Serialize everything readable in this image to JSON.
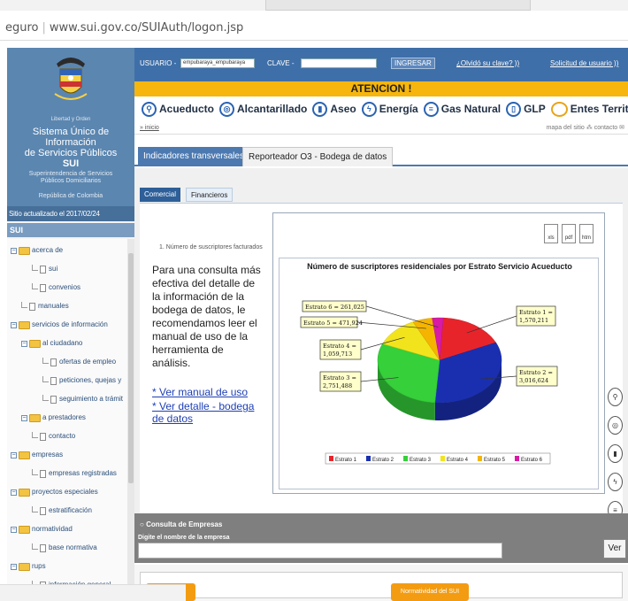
{
  "browser": {
    "url_prefix": "eguro",
    "url": "www.sui.gov.co/SUIAuth/logon.jsp"
  },
  "sidebar": {
    "crest_caption": "Libertad y Orden",
    "title_line1": "Sistema Único de Información",
    "title_line2": "de Servicios Públicos",
    "title_line3": "SUI",
    "sub_line1": "Superintendencia de Servicios",
    "sub_line2": "Públicos Domiciliarios",
    "sub_line3": "República de Colombia",
    "updated": "Sitio actualizado el 2017/02/24",
    "section": "SUI",
    "tree": [
      {
        "label": "acerca de",
        "type": "folder"
      },
      {
        "label": "sui",
        "type": "doc"
      },
      {
        "label": "convenios",
        "type": "doc"
      },
      {
        "label": "manuales",
        "type": "doc"
      },
      {
        "label": "servicios de información",
        "type": "folder"
      },
      {
        "label": "al ciudadano",
        "type": "folder"
      },
      {
        "label": "ofertas de empleo",
        "type": "doc"
      },
      {
        "label": "peticiones, quejas y",
        "type": "doc"
      },
      {
        "label": "seguimiento a trámit",
        "type": "doc"
      },
      {
        "label": "a prestadores",
        "type": "folder"
      },
      {
        "label": "contacto",
        "type": "doc"
      },
      {
        "label": "empresas",
        "type": "folder"
      },
      {
        "label": "empresas registradas",
        "type": "doc"
      },
      {
        "label": "proyectos especiales",
        "type": "folder"
      },
      {
        "label": "estratificación",
        "type": "doc"
      },
      {
        "label": "normatividad",
        "type": "folder"
      },
      {
        "label": "base normativa",
        "type": "doc"
      },
      {
        "label": "rups",
        "type": "folder"
      },
      {
        "label": "información general",
        "type": "doc"
      }
    ]
  },
  "login": {
    "user_label": "USUARIO -",
    "user_value": "empubaraya_empubaraya",
    "pass_label": "CLAVE -",
    "login_button": "INGRESAR",
    "forgot_link": "¿Olvidó su clave? ))",
    "request_link": "Solicitud de usuario ))"
  },
  "banner": "ATENCION !",
  "services": [
    "Acueducto",
    "Alcantarillado",
    "Aseo",
    "Energía",
    "Gas Natural",
    "GLP",
    "Entes Territoriales"
  ],
  "breadcrumb": {
    "home": "» inicio",
    "sitemap": "mapa del sitio",
    "contact": "contacto"
  },
  "tabs": [
    "Indicadores transversales",
    "Reporteador O3 - Bodega de datos"
  ],
  "subtabs": [
    "Comercial",
    "Financieros"
  ],
  "pane": {
    "metric_label": "1. Número de suscriptores facturados",
    "info_text": "Para una consulta más efectiva del detalle de la información de la bodega de datos, le recomendamos leer el manual de uso de la herramienta de análisis.",
    "link_manual": "* Ver manual de uso",
    "link_detalle": "* Ver detalle - bodega de datos",
    "export": [
      "xls",
      "pdf",
      "htm"
    ]
  },
  "chart_data": {
    "type": "pie",
    "title": "Número de suscriptores residenciales por Estrato Servicio Acueducto",
    "categories": [
      "Estrato 1",
      "Estrato 2",
      "Estrato 3",
      "Estrato 4",
      "Estrato 5",
      "Estrato 6"
    ],
    "values": [
      1570211,
      3016624,
      2751488,
      1059713,
      471924,
      261025
    ],
    "labels": [
      "Estrato 1 = 1,570,211",
      "Estrato 2 = 3,016,624",
      "Estrato 3 = 2,751,488",
      "Estrato 4 = 1,059,713",
      "Estrato 5 = 471,924",
      "Estrato 6 = 261,025"
    ],
    "colors": [
      "#e8242b",
      "#1a2fb0",
      "#35d03a",
      "#f2e41c",
      "#f4b400",
      "#d81aa6"
    ],
    "legend_position": "bottom"
  },
  "consulta": {
    "title": "Consulta de Empresas",
    "hint": "Digite el nombre de la empresa",
    "button": "Ver"
  },
  "footer": {
    "normatividad": "Normatividad del SUI"
  }
}
